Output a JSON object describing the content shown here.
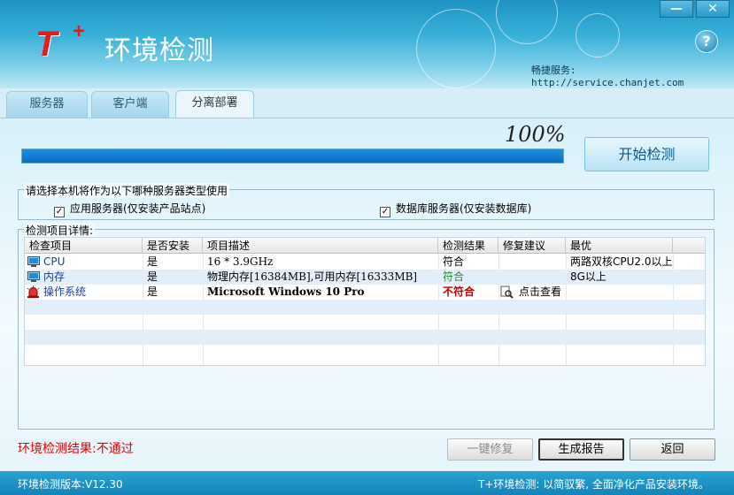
{
  "window": {
    "title": "环境检测",
    "logo_text": "T",
    "logo_plus": "+",
    "minimize": "—",
    "close": "✕",
    "help": "?",
    "service_text": "畅捷服务: http://service.chanjet.com"
  },
  "tabs": [
    {
      "label": "服务器",
      "active": false
    },
    {
      "label": "客户端",
      "active": false
    },
    {
      "label": "分离部署",
      "active": true
    }
  ],
  "progress": {
    "percent_text": "100%",
    "value": 1.0
  },
  "start_button": "开始检测",
  "server_type": {
    "legend": "请选择本机将作为以下哪种服务器类型使用",
    "options": [
      {
        "label": "应用服务器(仅安装产品站点)",
        "checked": true
      },
      {
        "label": "数据库服务器(仅安装数据库)",
        "checked": true
      }
    ]
  },
  "details": {
    "legend": "检测项目详情:",
    "columns": [
      "检查项目",
      "是否安装",
      "项目描述",
      "检测结果",
      "修复建议",
      "最优"
    ],
    "rows": [
      {
        "icon": "computer-icon",
        "item": "CPU",
        "installed": "是",
        "desc": "16 * 3.9GHz",
        "result": "符合",
        "result_status": "pass-black",
        "fix": "",
        "best": "两路双核CPU2.0以上"
      },
      {
        "icon": "computer-icon",
        "item": "内存",
        "installed": "是",
        "desc": "物理内存[16384MB],可用内存[16333MB]",
        "result": "符合",
        "result_status": "pass-green",
        "fix": "",
        "best": "8G以上"
      },
      {
        "icon": "alarm-icon",
        "item": "操作系统",
        "installed": "是",
        "desc": "Microsoft Windows 10 Pro",
        "result": "不符合",
        "result_status": "fail",
        "fix": "点击查看",
        "best": ""
      }
    ]
  },
  "result_summary": "环境检测结果:不通过",
  "buttons": {
    "repair": "一键修复",
    "report": "生成报告",
    "back": "返回"
  },
  "footer": {
    "version": "环境检测版本:V12.30",
    "slogan": "T+环境检测: 以简驭繁, 全面净化产品安装环境。"
  },
  "colors": {
    "accent": "#1e93c3",
    "fail": "#c00000",
    "pass": "#2a8a2a",
    "progress": "#1e8fe0"
  }
}
